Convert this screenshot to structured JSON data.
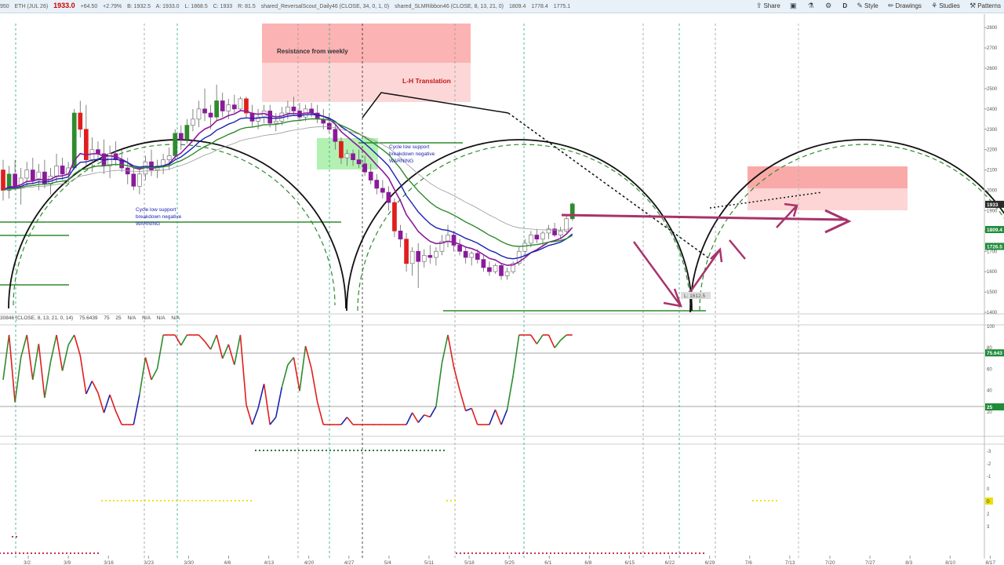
{
  "toolbar": {
    "price_info": [
      "950",
      "L: 1868.5",
      "C: 1933",
      "R: 81.5",
      "shared_ReversalScout_Daily46 (CLOSE, 34, 0, 1, 0)",
      "shared_SLMRibbon46 (CLOSE, 8, 13, 21, 0)",
      "1809.4",
      "1778.4",
      "1775.1"
    ],
    "symbol": "ETH (JUL 26)",
    "last_price": "1933.0",
    "change": "+64.50",
    "change_pct": "+2.79%",
    "bid": "B: 1932.5",
    "ask": "A: 1933.0",
    "buttons": {
      "share": "Share",
      "style": "Style",
      "drawings": "Drawings",
      "studies": "Studies",
      "patterns": "Patterns",
      "period": "D"
    },
    "icons": {
      "share": "share-icon",
      "save": "save-icon",
      "flask": "flask-icon",
      "gear": "gear-icon",
      "style": "style-icon",
      "drawings": "pencil-icon",
      "studies": "studies-icon",
      "patterns": "patterns-icon"
    }
  },
  "indicator_label": [
    "30846 (CLOSE, 8, 13, 21, 0, 14)",
    "75.6439",
    "75",
    "25",
    "N/A",
    "N/A",
    "N/A",
    "N/A"
  ],
  "annotations": {
    "resistance": "Resistance from weekly",
    "lh": "L-H Translation",
    "warning1": [
      "Cycle low support",
      "breakdown negative",
      "WARNING"
    ],
    "warning2": [
      "Cycle low support",
      "breakdown negative",
      "WARNING"
    ],
    "low_label": "L: 1612.5"
  },
  "colors": {
    "up": "#2e8b2e",
    "down": "#e01e1e",
    "purple": "#8b1a9b",
    "blue": "#1a23b0",
    "magenta": "#a8336b",
    "price_badge": "#2a2a2a",
    "green_badge": "#1e8c3a"
  },
  "chart_data": [
    {
      "type": "candlestick",
      "x": [
        "2/26",
        "2/27",
        "3/2",
        "3/3",
        "3/4",
        "3/5",
        "3/6",
        "3/9",
        "3/10",
        "3/11",
        "3/12",
        "3/13",
        "3/16",
        "3/17",
        "3/18",
        "3/19",
        "3/20",
        "3/23",
        "3/24",
        "3/25",
        "3/26",
        "3/27",
        "3/30",
        "3/31",
        "4/1",
        "4/2",
        "4/3",
        "4/6",
        "4/7",
        "4/8",
        "4/9",
        "4/10",
        "4/13",
        "4/14",
        "4/15",
        "4/16",
        "4/17",
        "4/20",
        "4/21",
        "4/22",
        "4/23",
        "4/24",
        "4/27",
        "4/28",
        "4/29",
        "4/30",
        "5/1",
        "5/4",
        "5/5",
        "5/6",
        "5/7",
        "5/8",
        "5/11",
        "5/12",
        "5/13",
        "5/14",
        "5/15",
        "5/18",
        "5/19",
        "5/20",
        "5/21",
        "5/22",
        "5/25",
        "5/26",
        "5/27",
        "5/28",
        "5/29",
        "6/1",
        "6/2",
        "6/3",
        "6/4",
        "6/5",
        "6/8",
        "6/9",
        "6/10",
        "6/11",
        "6/12",
        "6/15",
        "6/16",
        "6/17",
        "6/18",
        "6/19",
        "6/22",
        "6/23",
        "6/24",
        "6/25",
        "6/26",
        "6/29",
        "6/30",
        "7/1",
        "7/2",
        "7/3",
        "7/6",
        "7/7",
        "7/8",
        "7/9",
        "7/10",
        "7/13",
        "7/14"
      ],
      "ohlc": [
        [
          2100,
          2150,
          1950,
          2000
        ],
        [
          2000,
          2120,
          1960,
          2080
        ],
        [
          2080,
          2150,
          2000,
          2020
        ],
        [
          2020,
          2110,
          1930,
          2060
        ],
        [
          2060,
          2140,
          2020,
          2100
        ],
        [
          2100,
          2160,
          2030,
          2050
        ],
        [
          2050,
          2130,
          2000,
          2090
        ],
        [
          2090,
          2150,
          2010,
          2030
        ],
        [
          2030,
          2110,
          1980,
          2070
        ],
        [
          2070,
          2180,
          2040,
          2120
        ],
        [
          2120,
          2160,
          2050,
          2080
        ],
        [
          2080,
          2140,
          2040,
          2110
        ],
        [
          2110,
          2400,
          2100,
          2380
        ],
        [
          2380,
          2440,
          2260,
          2300
        ],
        [
          2300,
          2420,
          2120,
          2150
        ],
        [
          2150,
          2260,
          2090,
          2200
        ],
        [
          2200,
          2240,
          2140,
          2180
        ],
        [
          2180,
          2250,
          2080,
          2120
        ],
        [
          2120,
          2220,
          2060,
          2180
        ],
        [
          2180,
          2240,
          2120,
          2150
        ],
        [
          2150,
          2200,
          2090,
          2110
        ],
        [
          2110,
          2160,
          2030,
          2080
        ],
        [
          2080,
          2120,
          2000,
          2020
        ],
        [
          2020,
          2110,
          1980,
          2080
        ],
        [
          2080,
          2170,
          2050,
          2140
        ],
        [
          2140,
          2200,
          2070,
          2100
        ],
        [
          2100,
          2150,
          2060,
          2120
        ],
        [
          2120,
          2180,
          2080,
          2150
        ],
        [
          2150,
          2210,
          2100,
          2170
        ],
        [
          2170,
          2300,
          2150,
          2280
        ],
        [
          2280,
          2320,
          2200,
          2250
        ],
        [
          2250,
          2350,
          2230,
          2320
        ],
        [
          2320,
          2400,
          2290,
          2350
        ],
        [
          2350,
          2440,
          2310,
          2400
        ],
        [
          2400,
          2500,
          2340,
          2380
        ],
        [
          2380,
          2420,
          2300,
          2360
        ],
        [
          2360,
          2520,
          2340,
          2440
        ],
        [
          2440,
          2480,
          2360,
          2390
        ],
        [
          2390,
          2450,
          2350,
          2420
        ],
        [
          2420,
          2470,
          2380,
          2400
        ],
        [
          2400,
          2460,
          2390,
          2450
        ],
        [
          2450,
          2460,
          2360,
          2380
        ],
        [
          2380,
          2420,
          2310,
          2340
        ],
        [
          2340,
          2400,
          2300,
          2360
        ],
        [
          2360,
          2420,
          2330,
          2390
        ],
        [
          2390,
          2420,
          2310,
          2330
        ],
        [
          2330,
          2380,
          2290,
          2340
        ],
        [
          2340,
          2410,
          2320,
          2380
        ],
        [
          2380,
          2440,
          2350,
          2410
        ],
        [
          2410,
          2460,
          2370,
          2390
        ],
        [
          2390,
          2430,
          2340,
          2360
        ],
        [
          2360,
          2420,
          2340,
          2400
        ],
        [
          2400,
          2430,
          2360,
          2380
        ],
        [
          2380,
          2420,
          2330,
          2350
        ],
        [
          2350,
          2400,
          2300,
          2330
        ],
        [
          2330,
          2380,
          2280,
          2300
        ],
        [
          2300,
          2320,
          2200,
          2240
        ],
        [
          2240,
          2260,
          2130,
          2160
        ],
        [
          2160,
          2200,
          2120,
          2180
        ],
        [
          2180,
          2200,
          2120,
          2150
        ],
        [
          2150,
          2200,
          2110,
          2130
        ],
        [
          2130,
          2170,
          2070,
          2090
        ],
        [
          2090,
          2130,
          2030,
          2050
        ],
        [
          2050,
          2080,
          1980,
          2010
        ],
        [
          2010,
          2050,
          1960,
          1990
        ],
        [
          1990,
          2020,
          1900,
          1940
        ],
        [
          1940,
          1960,
          1770,
          1800
        ],
        [
          1800,
          1830,
          1720,
          1760
        ],
        [
          1760,
          1790,
          1600,
          1640
        ],
        [
          1640,
          1720,
          1580,
          1700
        ],
        [
          1700,
          1740,
          1520,
          1650
        ],
        [
          1650,
          1710,
          1620,
          1680
        ],
        [
          1680,
          1730,
          1640,
          1670
        ],
        [
          1670,
          1720,
          1630,
          1700
        ],
        [
          1700,
          1780,
          1680,
          1750
        ],
        [
          1750,
          1830,
          1720,
          1780
        ],
        [
          1780,
          1800,
          1700,
          1730
        ],
        [
          1730,
          1760,
          1680,
          1700
        ],
        [
          1700,
          1720,
          1640,
          1670
        ],
        [
          1670,
          1700,
          1630,
          1690
        ],
        [
          1690,
          1710,
          1640,
          1660
        ],
        [
          1660,
          1680,
          1600,
          1620
        ],
        [
          1620,
          1650,
          1580,
          1600
        ],
        [
          1600,
          1640,
          1590,
          1630
        ],
        [
          1630,
          1640,
          1560,
          1580
        ],
        [
          1580,
          1620,
          1560,
          1600
        ],
        [
          1600,
          1650,
          1590,
          1640
        ],
        [
          1640,
          1720,
          1630,
          1700
        ],
        [
          1700,
          1760,
          1680,
          1740
        ],
        [
          1740,
          1800,
          1720,
          1780
        ],
        [
          1780,
          1810,
          1740,
          1760
        ],
        [
          1760,
          1800,
          1730,
          1790
        ],
        [
          1790,
          1830,
          1760,
          1810
        ],
        [
          1810,
          1840,
          1770,
          1780
        ],
        [
          1780,
          1820,
          1760,
          1800
        ],
        [
          1800,
          1880,
          1790,
          1860
        ],
        [
          1860,
          1940,
          1850,
          1933
        ]
      ],
      "ylim": [
        1400,
        2820
      ],
      "y_ticks": [
        1400,
        1500,
        1600,
        1700,
        1800,
        1900,
        2000,
        2100,
        2200,
        2300,
        2400,
        2500,
        2600,
        2700,
        2800
      ],
      "price_badges": [
        "1933",
        "1809.4",
        "1726.5"
      ],
      "x_tick_labels": [
        "3/2",
        "3/9",
        "3/16",
        "3/23",
        "3/30",
        "4/6",
        "4/13",
        "4/20",
        "4/27",
        "5/4",
        "5/11",
        "5/18",
        "5/25",
        "6/1",
        "6/8",
        "6/15",
        "6/22",
        "6/29",
        "7/6",
        "7/13",
        "7/20",
        "7/27",
        "8/3",
        "8/10",
        "8/17"
      ]
    },
    {
      "type": "line",
      "ylim": [
        0,
        100
      ],
      "y_ticks": [
        20,
        40,
        60,
        80,
        100
      ],
      "levels": [
        75,
        25
      ],
      "badges": [
        "75.643",
        "25"
      ]
    },
    {
      "type": "dots",
      "y_ticks": [
        "-3",
        "-2",
        "-1",
        "0",
        "1",
        "2",
        "3"
      ],
      "badge": "0"
    }
  ]
}
